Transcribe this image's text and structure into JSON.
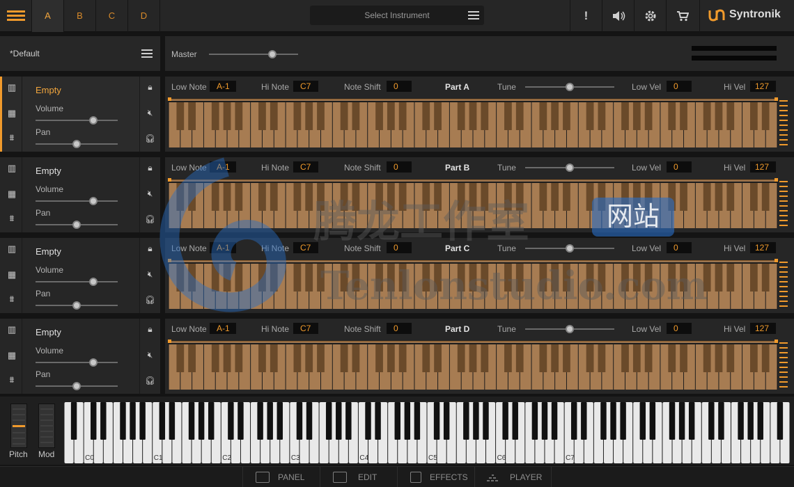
{
  "header": {
    "part_tabs": [
      "A",
      "B",
      "C",
      "D"
    ],
    "active_tab": 0,
    "instrument_select": "Select Instrument",
    "alert_glyph": "!",
    "brand_name": "Syntronik",
    "accent_color": "#f09a2c"
  },
  "preset": {
    "name": "*Default"
  },
  "master": {
    "label": "Master",
    "level": 0.7
  },
  "part_labels": {
    "volume": "Volume",
    "pan": "Pan",
    "low_note": "Low Note",
    "hi_note": "Hi Note",
    "note_shift": "Note Shift",
    "tune": "Tune",
    "low_vel": "Low Vel",
    "hi_vel": "Hi Vel"
  },
  "parts": [
    {
      "title": "Part A",
      "instrument": "Empty",
      "active": true,
      "volume": 0.7,
      "pan": 0.5,
      "low_note": "A-1",
      "hi_note": "C7",
      "note_shift": "0",
      "tune": 0.5,
      "low_vel": "0",
      "hi_vel": "127"
    },
    {
      "title": "Part B",
      "instrument": "Empty",
      "active": false,
      "volume": 0.7,
      "pan": 0.5,
      "low_note": "A-1",
      "hi_note": "C7",
      "note_shift": "0",
      "tune": 0.5,
      "low_vel": "0",
      "hi_vel": "127"
    },
    {
      "title": "Part C",
      "instrument": "Empty",
      "active": false,
      "volume": 0.7,
      "pan": 0.5,
      "low_note": "A-1",
      "hi_note": "C7",
      "note_shift": "0",
      "tune": 0.5,
      "low_vel": "0",
      "hi_vel": "127"
    },
    {
      "title": "Part D",
      "instrument": "Empty",
      "active": false,
      "volume": 0.7,
      "pan": 0.5,
      "low_note": "A-1",
      "hi_note": "C7",
      "note_shift": "0",
      "tune": 0.5,
      "low_vel": "0",
      "hi_vel": "127"
    }
  ],
  "wheels": {
    "pitch": "Pitch",
    "mod": "Mod"
  },
  "keyboard": {
    "octave_labels": [
      "C0",
      "C1",
      "C2",
      "C3",
      "C4",
      "C5",
      "C6",
      "C7"
    ]
  },
  "bottom_nav": [
    "PANEL",
    "EDIT",
    "EFFECTS",
    "PLAYER"
  ],
  "watermark": {
    "text_cn": "腾龙工作室",
    "badge": "网站",
    "url": "Tenlonstudio.com"
  }
}
